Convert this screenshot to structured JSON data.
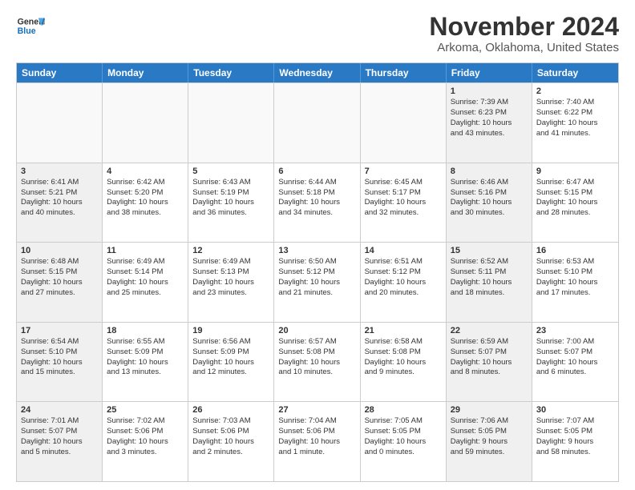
{
  "header": {
    "logo_general": "General",
    "logo_blue": "Blue",
    "month": "November 2024",
    "location": "Arkoma, Oklahoma, United States"
  },
  "weekdays": [
    "Sunday",
    "Monday",
    "Tuesday",
    "Wednesday",
    "Thursday",
    "Friday",
    "Saturday"
  ],
  "weeks": [
    [
      {
        "day": "",
        "info": "",
        "empty": true
      },
      {
        "day": "",
        "info": "",
        "empty": true
      },
      {
        "day": "",
        "info": "",
        "empty": true
      },
      {
        "day": "",
        "info": "",
        "empty": true
      },
      {
        "day": "",
        "info": "",
        "empty": true
      },
      {
        "day": "1",
        "info": "Sunrise: 7:39 AM\nSunset: 6:23 PM\nDaylight: 10 hours\nand 43 minutes.",
        "shaded": true
      },
      {
        "day": "2",
        "info": "Sunrise: 7:40 AM\nSunset: 6:22 PM\nDaylight: 10 hours\nand 41 minutes.",
        "shaded": false
      }
    ],
    [
      {
        "day": "3",
        "info": "Sunrise: 6:41 AM\nSunset: 5:21 PM\nDaylight: 10 hours\nand 40 minutes.",
        "shaded": true
      },
      {
        "day": "4",
        "info": "Sunrise: 6:42 AM\nSunset: 5:20 PM\nDaylight: 10 hours\nand 38 minutes.",
        "shaded": false
      },
      {
        "day": "5",
        "info": "Sunrise: 6:43 AM\nSunset: 5:19 PM\nDaylight: 10 hours\nand 36 minutes.",
        "shaded": false
      },
      {
        "day": "6",
        "info": "Sunrise: 6:44 AM\nSunset: 5:18 PM\nDaylight: 10 hours\nand 34 minutes.",
        "shaded": false
      },
      {
        "day": "7",
        "info": "Sunrise: 6:45 AM\nSunset: 5:17 PM\nDaylight: 10 hours\nand 32 minutes.",
        "shaded": false
      },
      {
        "day": "8",
        "info": "Sunrise: 6:46 AM\nSunset: 5:16 PM\nDaylight: 10 hours\nand 30 minutes.",
        "shaded": true
      },
      {
        "day": "9",
        "info": "Sunrise: 6:47 AM\nSunset: 5:15 PM\nDaylight: 10 hours\nand 28 minutes.",
        "shaded": false
      }
    ],
    [
      {
        "day": "10",
        "info": "Sunrise: 6:48 AM\nSunset: 5:15 PM\nDaylight: 10 hours\nand 27 minutes.",
        "shaded": true
      },
      {
        "day": "11",
        "info": "Sunrise: 6:49 AM\nSunset: 5:14 PM\nDaylight: 10 hours\nand 25 minutes.",
        "shaded": false
      },
      {
        "day": "12",
        "info": "Sunrise: 6:49 AM\nSunset: 5:13 PM\nDaylight: 10 hours\nand 23 minutes.",
        "shaded": false
      },
      {
        "day": "13",
        "info": "Sunrise: 6:50 AM\nSunset: 5:12 PM\nDaylight: 10 hours\nand 21 minutes.",
        "shaded": false
      },
      {
        "day": "14",
        "info": "Sunrise: 6:51 AM\nSunset: 5:12 PM\nDaylight: 10 hours\nand 20 minutes.",
        "shaded": false
      },
      {
        "day": "15",
        "info": "Sunrise: 6:52 AM\nSunset: 5:11 PM\nDaylight: 10 hours\nand 18 minutes.",
        "shaded": true
      },
      {
        "day": "16",
        "info": "Sunrise: 6:53 AM\nSunset: 5:10 PM\nDaylight: 10 hours\nand 17 minutes.",
        "shaded": false
      }
    ],
    [
      {
        "day": "17",
        "info": "Sunrise: 6:54 AM\nSunset: 5:10 PM\nDaylight: 10 hours\nand 15 minutes.",
        "shaded": true
      },
      {
        "day": "18",
        "info": "Sunrise: 6:55 AM\nSunset: 5:09 PM\nDaylight: 10 hours\nand 13 minutes.",
        "shaded": false
      },
      {
        "day": "19",
        "info": "Sunrise: 6:56 AM\nSunset: 5:09 PM\nDaylight: 10 hours\nand 12 minutes.",
        "shaded": false
      },
      {
        "day": "20",
        "info": "Sunrise: 6:57 AM\nSunset: 5:08 PM\nDaylight: 10 hours\nand 10 minutes.",
        "shaded": false
      },
      {
        "day": "21",
        "info": "Sunrise: 6:58 AM\nSunset: 5:08 PM\nDaylight: 10 hours\nand 9 minutes.",
        "shaded": false
      },
      {
        "day": "22",
        "info": "Sunrise: 6:59 AM\nSunset: 5:07 PM\nDaylight: 10 hours\nand 8 minutes.",
        "shaded": true
      },
      {
        "day": "23",
        "info": "Sunrise: 7:00 AM\nSunset: 5:07 PM\nDaylight: 10 hours\nand 6 minutes.",
        "shaded": false
      }
    ],
    [
      {
        "day": "24",
        "info": "Sunrise: 7:01 AM\nSunset: 5:07 PM\nDaylight: 10 hours\nand 5 minutes.",
        "shaded": true
      },
      {
        "day": "25",
        "info": "Sunrise: 7:02 AM\nSunset: 5:06 PM\nDaylight: 10 hours\nand 3 minutes.",
        "shaded": false
      },
      {
        "day": "26",
        "info": "Sunrise: 7:03 AM\nSunset: 5:06 PM\nDaylight: 10 hours\nand 2 minutes.",
        "shaded": false
      },
      {
        "day": "27",
        "info": "Sunrise: 7:04 AM\nSunset: 5:06 PM\nDaylight: 10 hours\nand 1 minute.",
        "shaded": false
      },
      {
        "day": "28",
        "info": "Sunrise: 7:05 AM\nSunset: 5:05 PM\nDaylight: 10 hours\nand 0 minutes.",
        "shaded": false
      },
      {
        "day": "29",
        "info": "Sunrise: 7:06 AM\nSunset: 5:05 PM\nDaylight: 9 hours\nand 59 minutes.",
        "shaded": true
      },
      {
        "day": "30",
        "info": "Sunrise: 7:07 AM\nSunset: 5:05 PM\nDaylight: 9 hours\nand 58 minutes.",
        "shaded": false
      }
    ]
  ]
}
